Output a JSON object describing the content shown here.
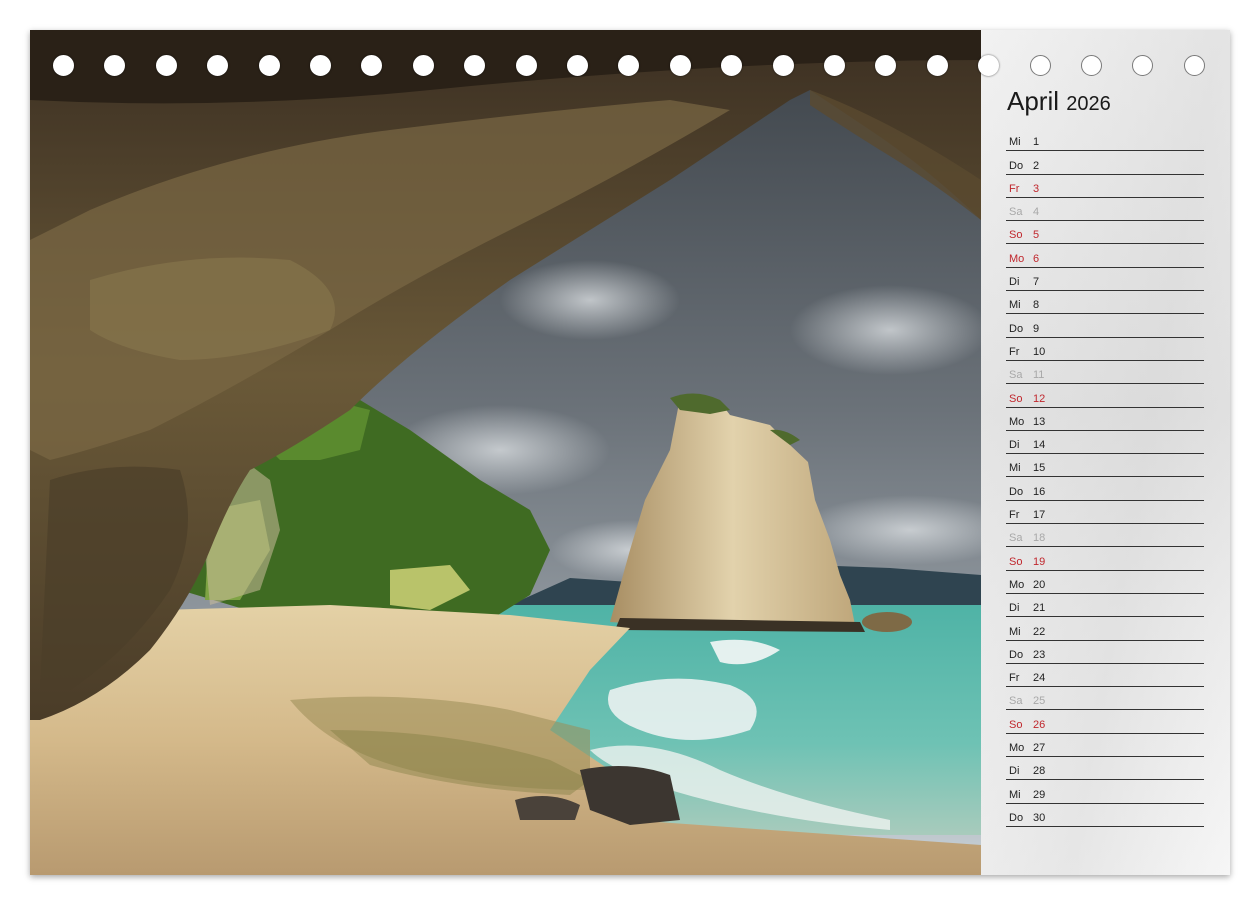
{
  "calendar": {
    "month": "April",
    "year": "2026",
    "days": [
      {
        "wd": "Mi",
        "d": "1",
        "type": "normal"
      },
      {
        "wd": "Do",
        "d": "2",
        "type": "normal"
      },
      {
        "wd": "Fr",
        "d": "3",
        "type": "holiday"
      },
      {
        "wd": "Sa",
        "d": "4",
        "type": "saturday"
      },
      {
        "wd": "So",
        "d": "5",
        "type": "holiday"
      },
      {
        "wd": "Mo",
        "d": "6",
        "type": "holiday"
      },
      {
        "wd": "Di",
        "d": "7",
        "type": "normal"
      },
      {
        "wd": "Mi",
        "d": "8",
        "type": "normal"
      },
      {
        "wd": "Do",
        "d": "9",
        "type": "normal"
      },
      {
        "wd": "Fr",
        "d": "10",
        "type": "normal"
      },
      {
        "wd": "Sa",
        "d": "11",
        "type": "saturday"
      },
      {
        "wd": "So",
        "d": "12",
        "type": "holiday"
      },
      {
        "wd": "Mo",
        "d": "13",
        "type": "normal"
      },
      {
        "wd": "Di",
        "d": "14",
        "type": "normal"
      },
      {
        "wd": "Mi",
        "d": "15",
        "type": "normal"
      },
      {
        "wd": "Do",
        "d": "16",
        "type": "normal"
      },
      {
        "wd": "Fr",
        "d": "17",
        "type": "normal"
      },
      {
        "wd": "Sa",
        "d": "18",
        "type": "saturday"
      },
      {
        "wd": "So",
        "d": "19",
        "type": "holiday"
      },
      {
        "wd": "Mo",
        "d": "20",
        "type": "normal"
      },
      {
        "wd": "Di",
        "d": "21",
        "type": "normal"
      },
      {
        "wd": "Mi",
        "d": "22",
        "type": "normal"
      },
      {
        "wd": "Do",
        "d": "23",
        "type": "normal"
      },
      {
        "wd": "Fr",
        "d": "24",
        "type": "normal"
      },
      {
        "wd": "Sa",
        "d": "25",
        "type": "saturday"
      },
      {
        "wd": "So",
        "d": "26",
        "type": "holiday"
      },
      {
        "wd": "Mo",
        "d": "27",
        "type": "normal"
      },
      {
        "wd": "Di",
        "d": "28",
        "type": "normal"
      },
      {
        "wd": "Mi",
        "d": "29",
        "type": "normal"
      },
      {
        "wd": "Do",
        "d": "30",
        "type": "normal"
      }
    ]
  },
  "colors": {
    "holiday": "#c0272d",
    "saturday": "#a8a8a8",
    "normal": "#222222"
  },
  "binding": {
    "hole_count": 23,
    "holes_on_photo": 19
  }
}
